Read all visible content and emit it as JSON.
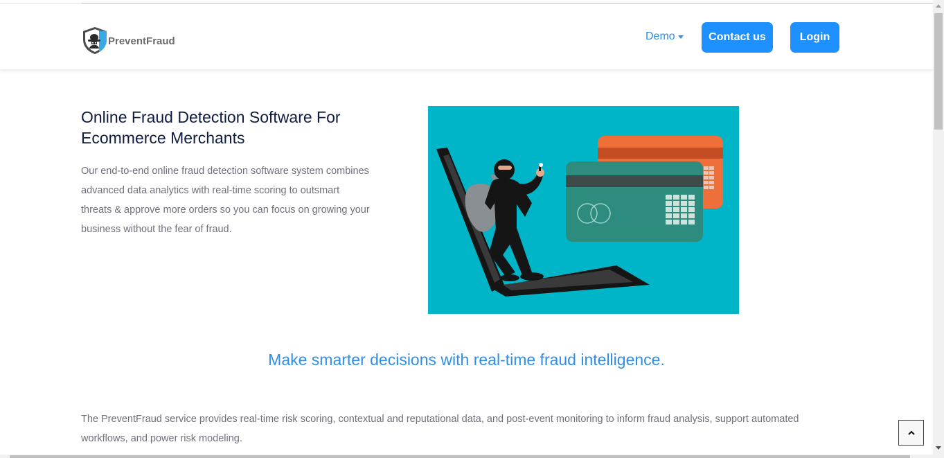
{
  "brand": {
    "name": "PreventFraud",
    "logo_icon": "shield-hacker-icon"
  },
  "nav": {
    "demo_label": "Demo",
    "contact_label": "Contact us",
    "login_label": "Login"
  },
  "hero": {
    "title_line1": "Online Fraud Detection Software For",
    "title_line2": "Ecommerce Merchants",
    "description": "Our end-to-end online fraud detection software system combines advanced data analytics with real-time scoring to outsmart threats & approve more orders so you can focus on growing your business without the fear of fraud.",
    "image_icon": "thief-laptop-credit-card-illustration"
  },
  "section": {
    "tagline": "Make smarter decisions with real-time fraud intelligence.",
    "description": "The PreventFraud service provides real-time risk scoring, contextual and reputational data, and post-event monitoring to inform fraud analysis, support automated workflows, and power risk modeling."
  },
  "colors": {
    "primary": "#1e90ff",
    "heading": "#0f1c3f",
    "body_text": "#6f6f7c",
    "hero_bg": "#00b5c7"
  }
}
